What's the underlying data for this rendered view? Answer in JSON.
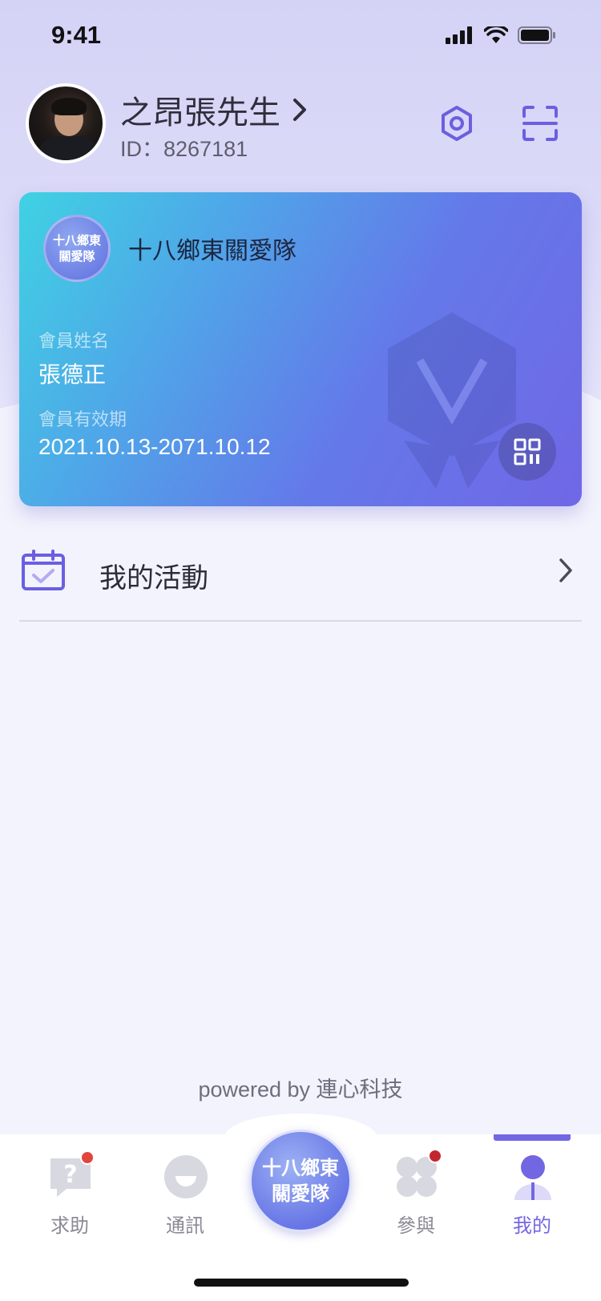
{
  "status_bar": {
    "time": "9:41"
  },
  "profile": {
    "name": "之昂張先生",
    "id_text": "ID：8267181"
  },
  "card": {
    "org_logo_text_line1": "十八鄉東",
    "org_logo_text_line2": "關愛隊",
    "org_name": "十八鄉東關愛隊",
    "member_name_label": "會員姓名",
    "member_name": "張德正",
    "validity_label": "會員有效期",
    "validity_value": "2021.10.13-2071.10.12"
  },
  "menu": {
    "activities_label": "我的活動"
  },
  "footer": {
    "powered_by": "powered by 連心科技"
  },
  "tabbar": {
    "tabs": [
      {
        "label": "求助",
        "icon": "help-question-icon",
        "badge": true
      },
      {
        "label": "通訊",
        "icon": "contact-icon",
        "badge": false
      },
      {
        "label": "十八鄉東關愛隊",
        "icon": "center-logo",
        "badge": false
      },
      {
        "label": "參與",
        "icon": "participate-icon",
        "badge": true
      },
      {
        "label": "我的",
        "icon": "person-icon",
        "badge": false,
        "active": true
      }
    ],
    "center_line1": "十八鄉東",
    "center_line2": "關愛隊"
  },
  "colors": {
    "accent": "#7366e3",
    "badge": "#e2453d",
    "inactive": "#8a8a96"
  }
}
